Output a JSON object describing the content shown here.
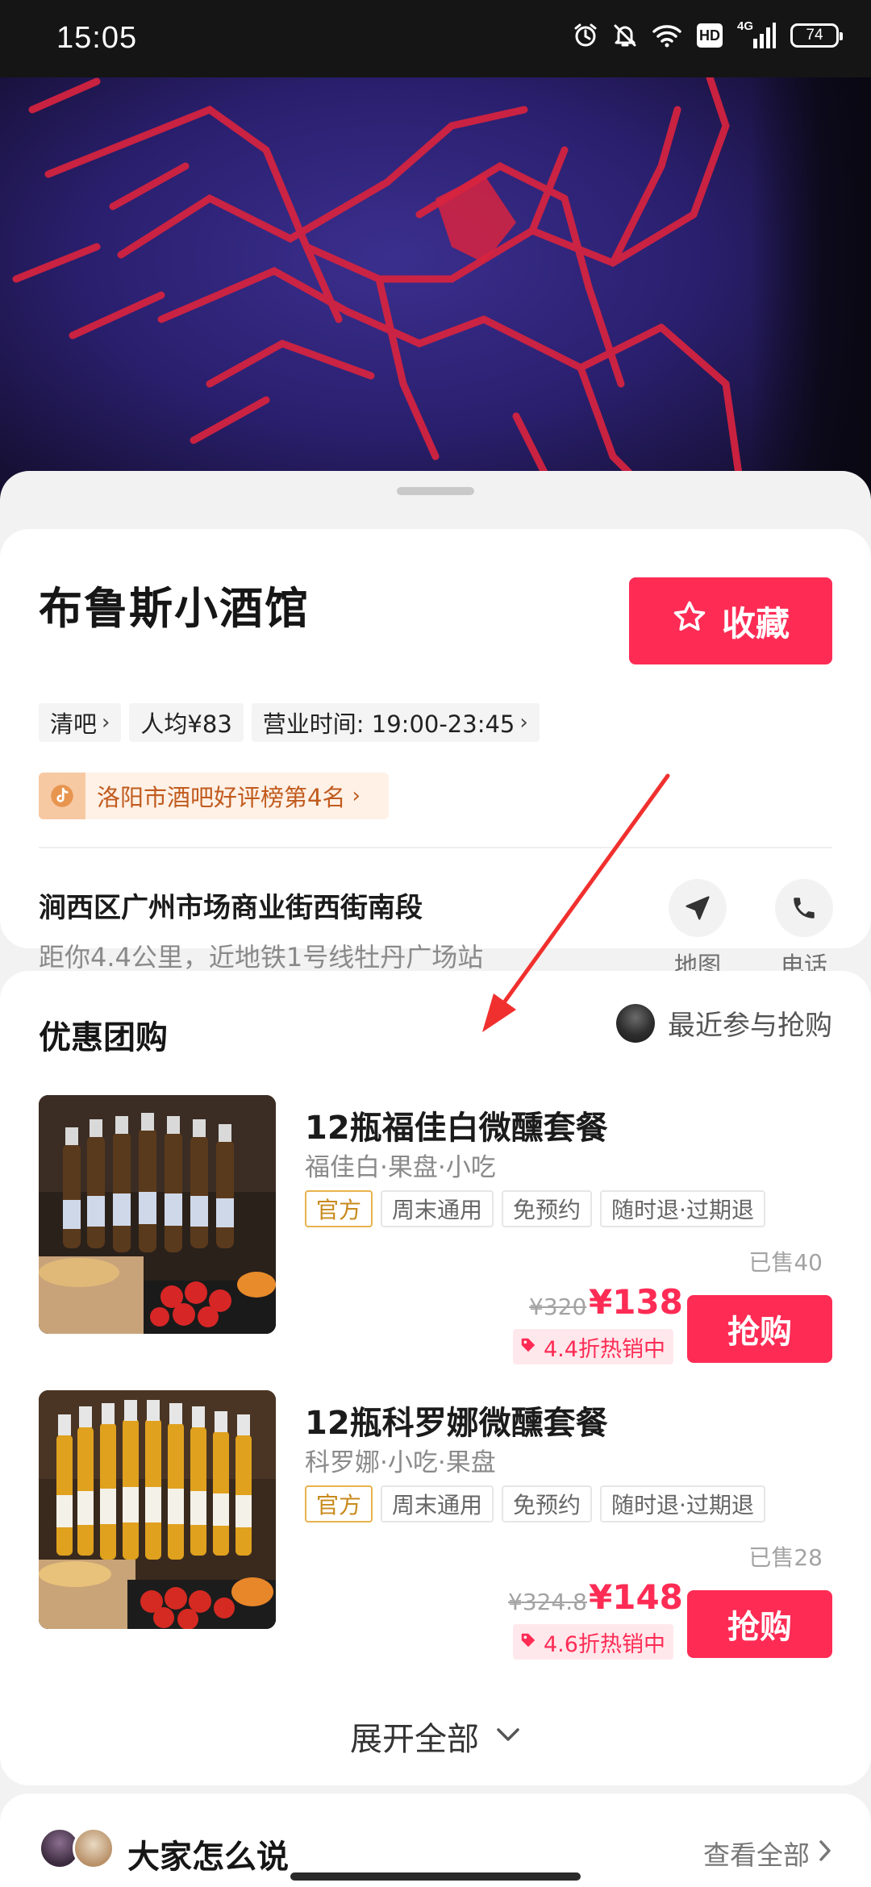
{
  "status_bar": {
    "time": "15:05",
    "hd_label": "HD",
    "network_label": "4G",
    "battery_level": "74"
  },
  "store": {
    "name": "布鲁斯小酒馆",
    "favorite_label": "收藏",
    "tags": [
      "清吧",
      "人均¥83",
      "营业时间: 19:00-23:45"
    ],
    "rank_text": "洛阳市酒吧好评榜第4名",
    "address": "涧西区广州市场商业街西街南段",
    "distance": "距你4.4公里，近地铁1号线牡丹广场站",
    "map_label": "地图",
    "phone_label": "电话"
  },
  "group_buy": {
    "title": "优惠团购",
    "recent_label": "最近参与抢购",
    "expand_label": "展开全部",
    "deals": [
      {
        "title": "12瓶福佳白微醺套餐",
        "subtitle": "福佳白·果盘·小吃",
        "tags": [
          "官方",
          "周末通用",
          "免预约",
          "随时退·过期退"
        ],
        "sold": "已售40",
        "price_old": "¥320",
        "price_new": "¥138",
        "discount": "4.4折热销中",
        "buy_label": "抢购"
      },
      {
        "title": "12瓶科罗娜微醺套餐",
        "subtitle": "科罗娜·小吃·果盘",
        "tags": [
          "官方",
          "周末通用",
          "免预约",
          "随时退·过期退"
        ],
        "sold": "已售28",
        "price_old": "¥324.8",
        "price_new": "¥148",
        "discount": "4.6折热销中",
        "buy_label": "抢购"
      }
    ]
  },
  "reviews": {
    "title": "大家怎么说",
    "view_all_label": "查看全部"
  },
  "colors": {
    "accent": "#fe2c55",
    "official_tag": "#e8b34e",
    "rank_text": "#c15b1e"
  },
  "icons": [
    "alarm-icon",
    "mute-icon",
    "wifi-icon",
    "signal-icon",
    "battery-icon",
    "star-icon",
    "douyin-icon",
    "navigation-icon",
    "phone-icon",
    "discount-tag-icon",
    "chevron-down-icon",
    "chevron-right-icon"
  ]
}
